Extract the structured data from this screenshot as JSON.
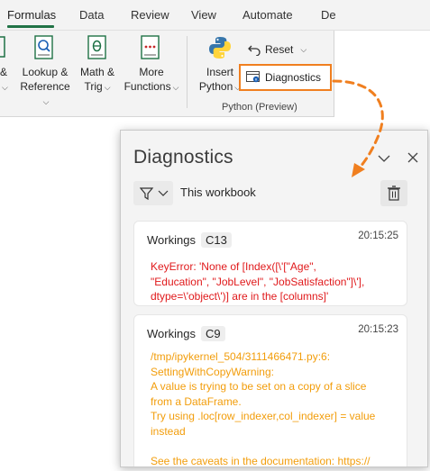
{
  "ribbon": {
    "tabs": [
      {
        "label": "Formulas",
        "active": true
      },
      {
        "label": "Data"
      },
      {
        "label": "Review"
      },
      {
        "label": "View"
      },
      {
        "label": "Automate"
      },
      {
        "label": "De"
      }
    ],
    "buttons": {
      "partial_line1": "&",
      "lookup_line1": "Lookup &",
      "lookup_line2": "Reference",
      "math_line1": "Math &",
      "math_line2": "Trig",
      "more_line1": "More",
      "more_line2": "Functions",
      "insert_line1": "Insert",
      "insert_line2": "Python",
      "reset": "Reset",
      "diagnostics": "Diagnostics"
    },
    "group_label": "Python (Preview)"
  },
  "pane": {
    "title": "Diagnostics",
    "filter_label": "This workbook",
    "entries": [
      {
        "source": "Workings",
        "cell": "C13",
        "time": "20:15:25",
        "level": "error",
        "message": "KeyError: 'None of [Index([\\'[\"Age\",\n\"Education\", \"JobLevel\", \"JobSatisfaction\"]\\'],\ndtype=\\'object\\')] are in the [columns]'"
      },
      {
        "source": "Workings",
        "cell": "C9",
        "time": "20:15:23",
        "level": "warning",
        "message": "/tmp/ipykernel_504/3111466471.py:6:\nSettingWithCopyWarning:\nA value is trying to be set on a copy of a slice\nfrom a DataFrame.\nTry using .loc[row_indexer,col_indexer] = value\ninstead\n\nSee the caveats in the documentation: https://"
      }
    ]
  },
  "colors": {
    "highlight": "#f07f1f",
    "error_text": "#e0191b",
    "warning_text": "#f29d0b",
    "tab_accent": "#217346"
  }
}
